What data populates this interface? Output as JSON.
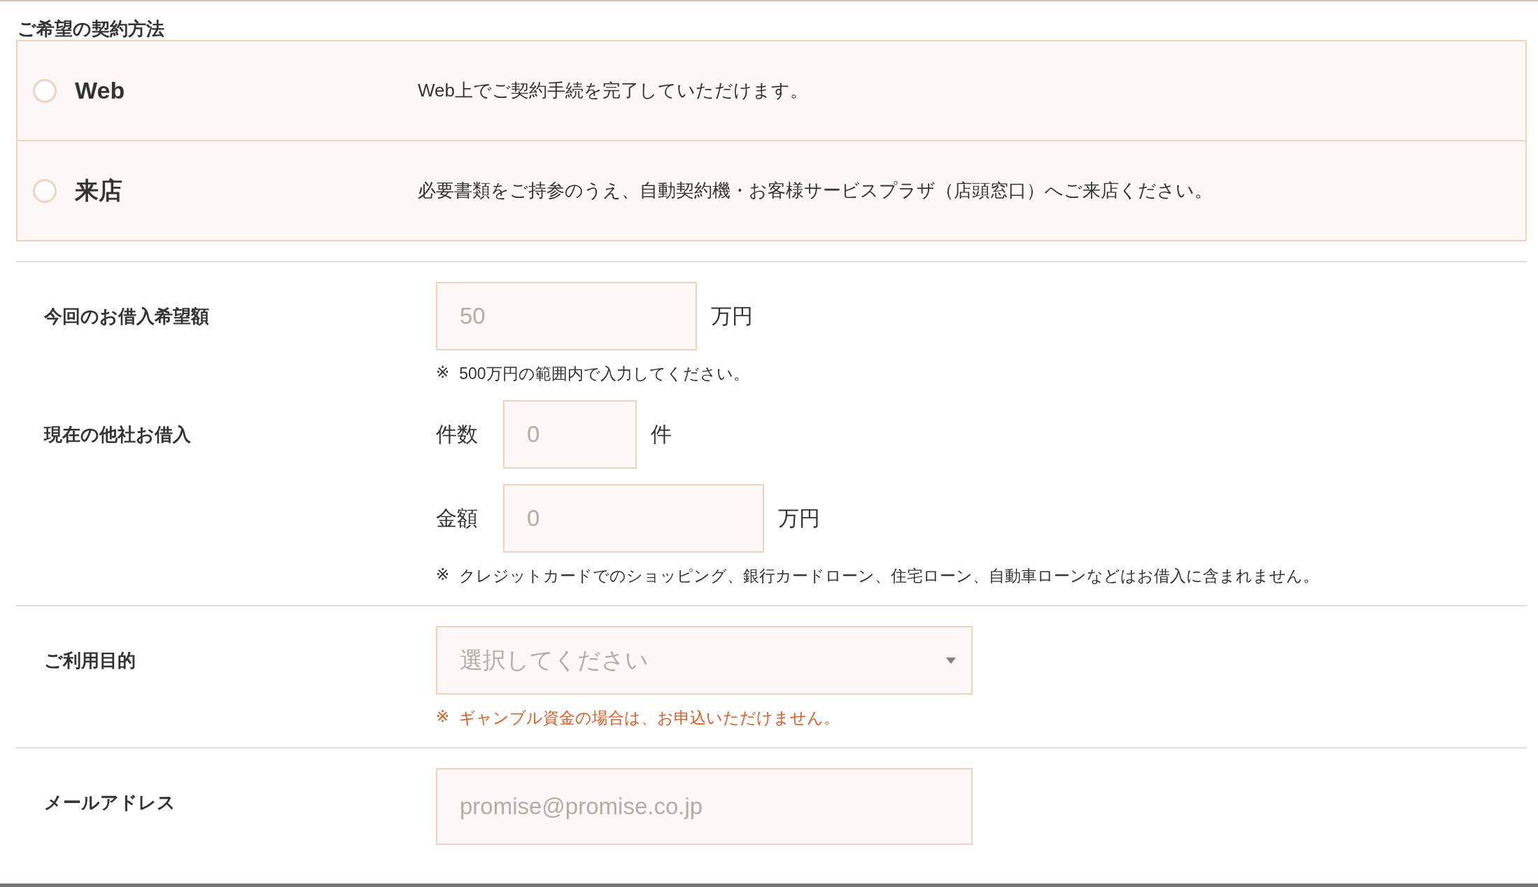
{
  "section_title": "ご希望の契約方法",
  "contract_options": [
    {
      "label": "Web",
      "description": "Web上でご契約手続を完了していただけます。",
      "selected": false
    },
    {
      "label": "来店",
      "description": "必要書類をご持参のうえ、自動契約機・お客様サービスプラザ（店頭窓口）へご来店ください。",
      "selected": false
    }
  ],
  "groups": [
    {
      "fields": [
        {
          "kind": "inputs",
          "label": "今回のお借入希望額",
          "inputs": [
            {
              "kind": "wide",
              "placeholder": "50",
              "unit": "万円"
            }
          ],
          "note": {
            "mark": "※",
            "text": "500万円の範囲内で入力してください。",
            "warning": false
          }
        },
        {
          "kind": "inputs",
          "label": "現在の他社お借入",
          "inputs": [
            {
              "kind": "short",
              "prefix": "件数",
              "placeholder": "0",
              "unit": "件"
            },
            {
              "kind": "wide",
              "prefix": "金額",
              "placeholder": "0",
              "unit": "万円"
            }
          ],
          "note": {
            "mark": "※",
            "text": "クレジットカードでのショッピング、銀行カードローン、住宅ローン、自動車ローンなどはお借入に含まれません。",
            "warning": false
          }
        }
      ]
    },
    {
      "fields": [
        {
          "kind": "select",
          "label": "ご利用目的",
          "placeholder": "選択してください",
          "note": {
            "mark": "※",
            "text": "ギャンブル資金の場合は、お申込いただけません。",
            "warning": true
          }
        }
      ]
    },
    {
      "fields": [
        {
          "kind": "email",
          "label": "メールアドレス",
          "placeholder": "promise@promise.co.jp"
        }
      ]
    }
  ]
}
